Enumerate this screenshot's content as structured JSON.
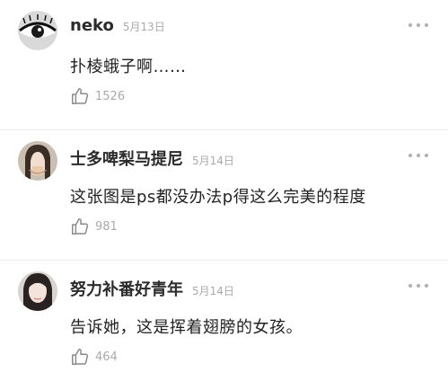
{
  "comments": [
    {
      "name": "neko",
      "date": "5月13日",
      "text": "扑棱蛾子啊……",
      "likes": "1526"
    },
    {
      "name": "士多啤梨马提尼",
      "date": "5月14日",
      "text": "这张图是ps都没办法p得这么完美的程度",
      "likes": "981"
    },
    {
      "name": "努力补番好青年",
      "date": "5月14日",
      "text": "告诉她，这是挥着翅膀的女孩。",
      "likes": "464"
    }
  ],
  "colors": {
    "name": "#2b2b2b",
    "meta": "#aaaaaa",
    "text": "#222222",
    "divider": "#ececec"
  },
  "icons": {
    "like": "thumbs-up-icon",
    "more": "more-dots-icon"
  }
}
